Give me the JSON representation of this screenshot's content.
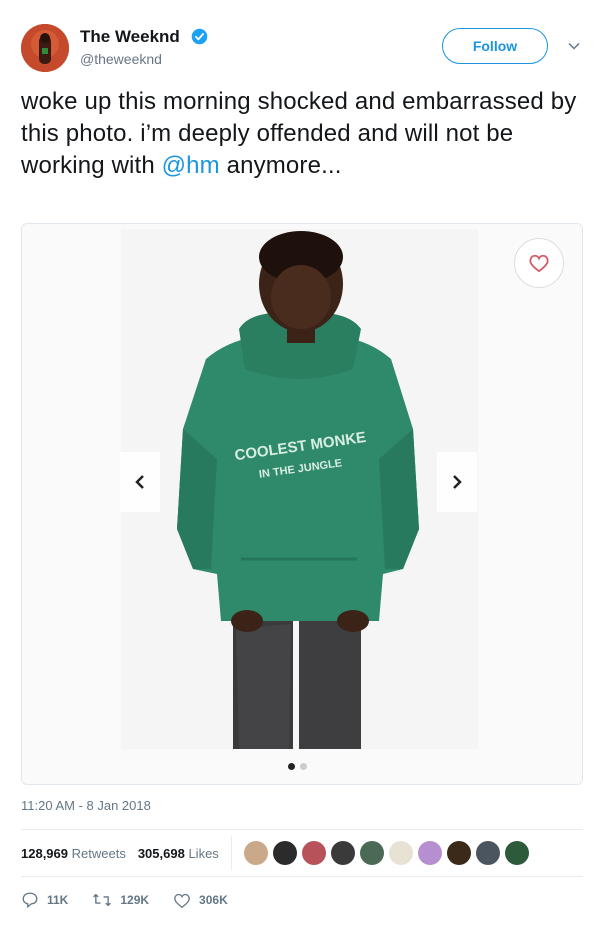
{
  "user": {
    "name": "The Weeknd",
    "handle": "@theweeknd",
    "verified": true
  },
  "follow_label": "Follow",
  "tweet": {
    "text_before": "woke up this morning shocked and embarrassed by this photo. i’m deeply offended and will not be working with ",
    "mention": "@hm",
    "text_after": " anymore..."
  },
  "media": {
    "hoodie_text_line1": "COOLEST MONKE",
    "hoodie_text_line2": "IN THE JUNGLE",
    "slide_count": 2,
    "active_slide": 1
  },
  "timestamp": "11:20 AM - 8 Jan 2018",
  "stats": {
    "retweets_count": "128,969",
    "retweets_label": "Retweets",
    "likes_count": "305,698",
    "likes_label": "Likes"
  },
  "actions": {
    "reply_count": "11K",
    "retweet_count": "129K",
    "like_count": "306K"
  },
  "colors": {
    "accent": "#1b95e0",
    "muted": "#657786",
    "hoodie": "#2e8a6a"
  }
}
